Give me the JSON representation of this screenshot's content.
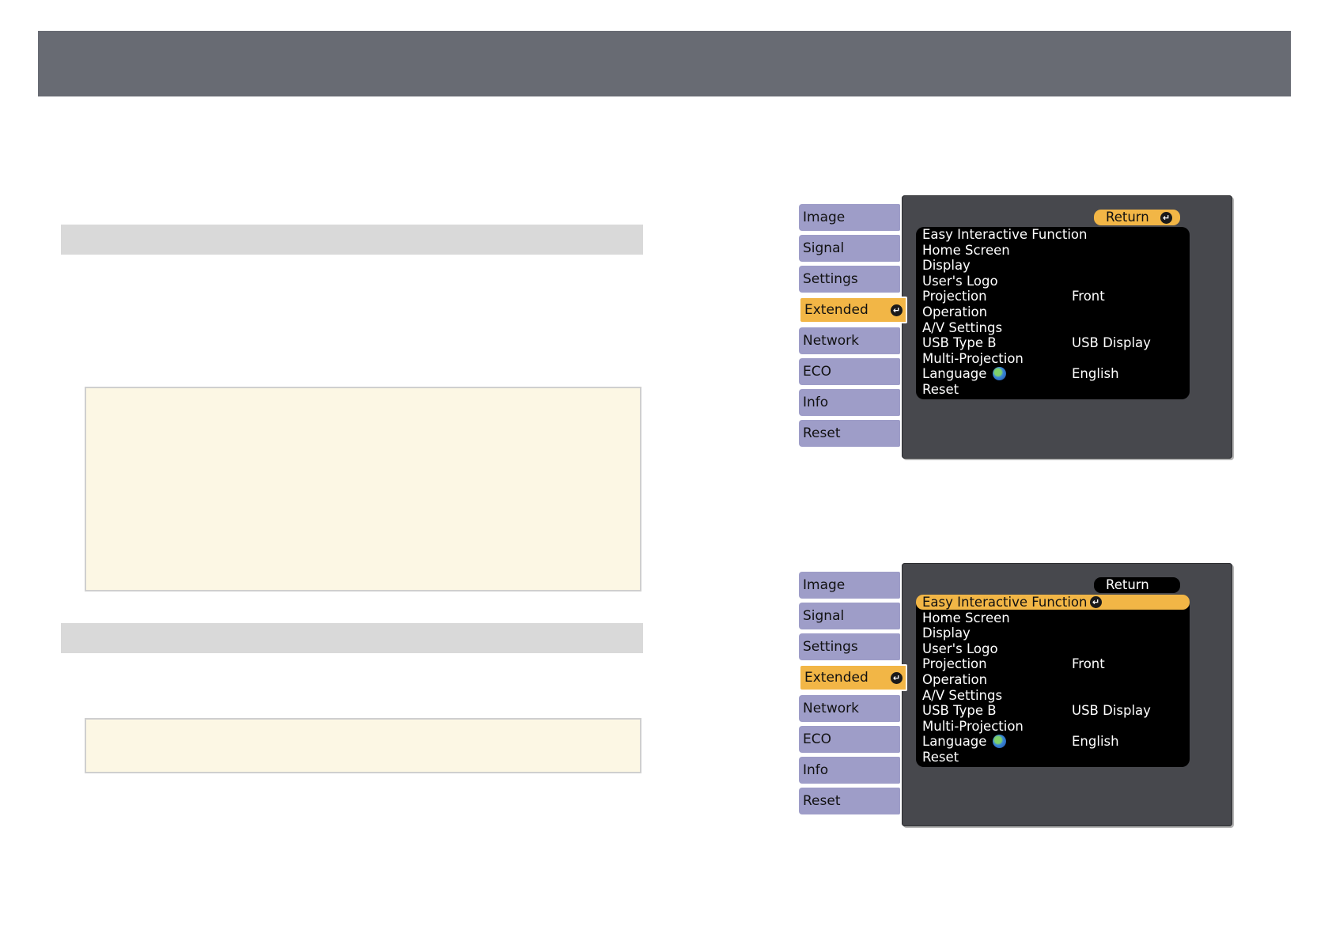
{
  "osd_top": {
    "tabs": [
      {
        "label": "Image"
      },
      {
        "label": "Signal"
      },
      {
        "label": "Settings"
      },
      {
        "label": "Extended"
      },
      {
        "label": "Network"
      },
      {
        "label": "ECO"
      },
      {
        "label": "Info"
      },
      {
        "label": "Reset"
      }
    ],
    "active_tab": "Extended",
    "return_label": "Return",
    "items": [
      {
        "label": "Easy Interactive Function",
        "value": ""
      },
      {
        "label": "Home Screen",
        "value": ""
      },
      {
        "label": "Display",
        "value": ""
      },
      {
        "label": "User's Logo",
        "value": ""
      },
      {
        "label": "Projection",
        "value": "Front"
      },
      {
        "label": "Operation",
        "value": ""
      },
      {
        "label": "A/V Settings",
        "value": ""
      },
      {
        "label": "USB Type B",
        "value": "USB Display"
      },
      {
        "label": "Multi-Projection",
        "value": ""
      },
      {
        "label": "Language",
        "value": "English"
      },
      {
        "label": "Reset",
        "value": ""
      }
    ]
  },
  "osd_bottom": {
    "tabs": [
      {
        "label": "Image"
      },
      {
        "label": "Signal"
      },
      {
        "label": "Settings"
      },
      {
        "label": "Extended"
      },
      {
        "label": "Network"
      },
      {
        "label": "ECO"
      },
      {
        "label": "Info"
      },
      {
        "label": "Reset"
      }
    ],
    "active_tab": "Extended",
    "return_label": "Return",
    "highlighted_item": "Easy Interactive Function",
    "items": [
      {
        "label": "Easy Interactive Function",
        "value": ""
      },
      {
        "label": "Home Screen",
        "value": ""
      },
      {
        "label": "Display",
        "value": ""
      },
      {
        "label": "User's Logo",
        "value": ""
      },
      {
        "label": "Projection",
        "value": "Front"
      },
      {
        "label": "Operation",
        "value": ""
      },
      {
        "label": "A/V Settings",
        "value": ""
      },
      {
        "label": "USB Type B",
        "value": "USB Display"
      },
      {
        "label": "Multi-Projection",
        "value": ""
      },
      {
        "label": "Language",
        "value": "English"
      },
      {
        "label": "Reset",
        "value": ""
      }
    ]
  },
  "colors": {
    "header": "#686b73",
    "band": "#d9d9d9",
    "note_bg": "#fcf7e4",
    "osd_panel": "#47484d",
    "tab": "#9e9dc8",
    "accent": "#f2b646"
  },
  "icons": {
    "enter": "enter-icon",
    "globe": "globe-icon"
  }
}
